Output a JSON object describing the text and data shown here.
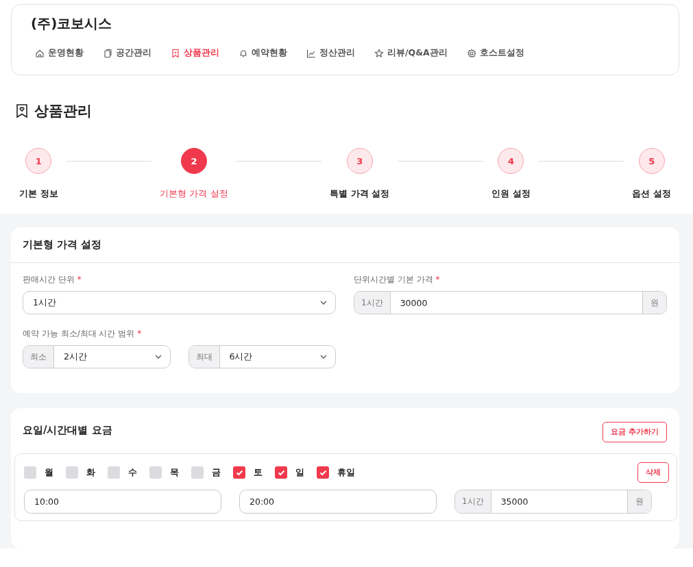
{
  "header": {
    "brand": "(주)코보시스",
    "nav": [
      {
        "label": "운영현황",
        "selected": false
      },
      {
        "label": "공간관리",
        "selected": false
      },
      {
        "label": "상품관리",
        "selected": true
      },
      {
        "label": "예약현황",
        "selected": false
      },
      {
        "label": "정산관리",
        "selected": false
      },
      {
        "label": "리뷰/Q&A관리",
        "selected": false
      },
      {
        "label": "호스트설정",
        "selected": false
      }
    ]
  },
  "page_title": "상품관리",
  "steps": [
    {
      "number": "1",
      "label": "기본 정보",
      "selected": false
    },
    {
      "number": "2",
      "label": "기본형 가격 설정",
      "selected": true
    },
    {
      "number": "3",
      "label": "특별 가격 설정",
      "selected": false
    },
    {
      "number": "4",
      "label": "인원 설정",
      "selected": false
    },
    {
      "number": "5",
      "label": "옵션 설정",
      "selected": false
    }
  ],
  "basic_pricing": {
    "title": "기본형 가격 설정",
    "sale_unit": {
      "label": "판매시간 단위",
      "required_mark": "*",
      "value": "1시간"
    },
    "base_price": {
      "label": "단위시간별 기본 가격",
      "required_mark": "*",
      "prefix": "1시간",
      "value": "30000",
      "suffix": "원"
    },
    "range": {
      "label": "예약 가능 최소/최대 시간 범위",
      "required_mark": "*",
      "min": {
        "prefix": "최소",
        "value": "2시간"
      },
      "max": {
        "prefix": "최대",
        "value": "6시간"
      }
    }
  },
  "schedule": {
    "title": "요일/시간대별 요금",
    "add_button": "요금 추가하기",
    "rules": [
      {
        "days": [
          {
            "label": "월",
            "checked": false
          },
          {
            "label": "화",
            "checked": false
          },
          {
            "label": "수",
            "checked": false
          },
          {
            "label": "목",
            "checked": false
          },
          {
            "label": "금",
            "checked": false
          },
          {
            "label": "토",
            "checked": true
          },
          {
            "label": "일",
            "checked": true
          },
          {
            "label": "휴일",
            "checked": true
          }
        ],
        "delete_button": "삭제",
        "start": "10:00",
        "end": "20:00",
        "prefix": "1시간",
        "price": "35000",
        "suffix": "원"
      }
    ]
  }
}
